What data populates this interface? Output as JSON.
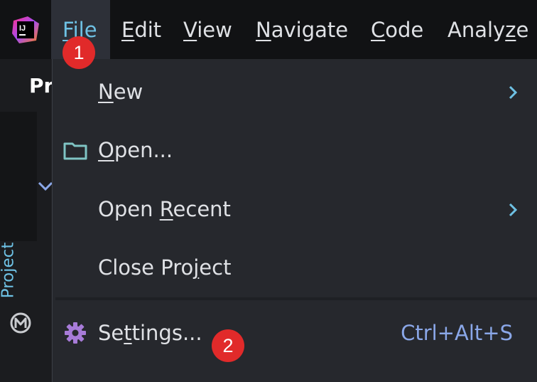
{
  "menubar": {
    "items": [
      {
        "label": "File",
        "underline": "F",
        "rest": "ile"
      },
      {
        "label": "Edit",
        "underline": "E",
        "rest": "dit"
      },
      {
        "label": "View",
        "underline": "V",
        "rest": "iew"
      },
      {
        "label": "Navigate",
        "underline": "N",
        "rest": "avigate"
      },
      {
        "label": "Code",
        "underline": "C",
        "rest": "ode"
      },
      {
        "label": "Analyze",
        "pre": "Analy",
        "underline": "z",
        "rest": "e"
      }
    ]
  },
  "sidebar": {
    "project_label": "Project",
    "partial_title": "Pr"
  },
  "file_menu": {
    "items": [
      {
        "pre": "",
        "underline": "N",
        "rest": "ew",
        "has_submenu": true
      },
      {
        "pre": "",
        "underline": "O",
        "rest": "pen...",
        "icon": "folder-icon"
      },
      {
        "pre": "Open ",
        "underline": "R",
        "rest": "ecent",
        "has_submenu": true
      },
      {
        "pre": "Close Pro",
        "underline": "j",
        "rest": "ect"
      },
      {
        "pre": "Se",
        "underline": "t",
        "rest": "tings...",
        "icon": "gear-icon",
        "shortcut": "Ctrl+Alt+S"
      }
    ]
  },
  "annotations": {
    "badge1": "1",
    "badge2": "2"
  },
  "colors": {
    "accent": "#6ec1e4",
    "badge": "#e12a2a",
    "shortcut": "#8aa7e8",
    "gear": "#a77bd8"
  }
}
